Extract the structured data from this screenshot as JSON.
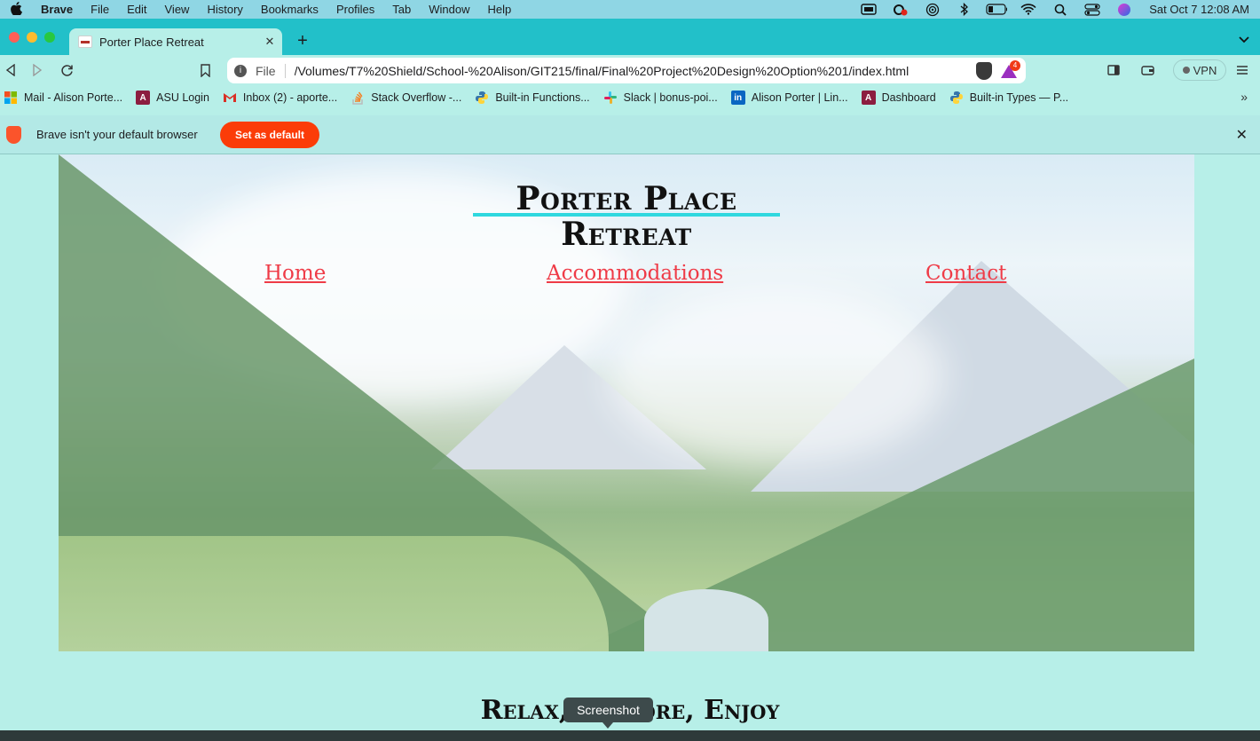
{
  "menubar": {
    "apple": "",
    "app": "Brave",
    "items": [
      "File",
      "Edit",
      "View",
      "History",
      "Bookmarks",
      "Profiles",
      "Tab",
      "Window",
      "Help"
    ],
    "clock": "Sat Oct 7  12:08 AM",
    "status_icons": [
      "screen-mirror-icon",
      "creative-cloud-icon",
      "airdrop-icon",
      "bluetooth-icon",
      "battery-icon",
      "wifi-icon",
      "spotlight-icon",
      "control-center-icon",
      "siri-icon"
    ]
  },
  "tabs": [
    {
      "title": "Porter Place Retreat",
      "close": "✕"
    }
  ],
  "toolbar": {
    "back": "◁",
    "forward": "▷",
    "reload": "↻",
    "bookmark": "⌑",
    "url_scheme": "File",
    "url": "/Volumes/T7%20Shield/School-%20Alison/GIT215/final/Final%20Project%20Design%20Option%201/index.html",
    "rewards_badge": "4",
    "vpn": "VPN"
  },
  "bookmarks": [
    {
      "label": "Mail - Alison Porte...",
      "icon": "microsoft-icon"
    },
    {
      "label": "ASU Login",
      "icon": "asu-icon"
    },
    {
      "label": "Inbox (2) - aporte...",
      "icon": "gmail-icon"
    },
    {
      "label": "Stack Overflow -...",
      "icon": "stackoverflow-icon"
    },
    {
      "label": "Built-in Functions...",
      "icon": "python-icon"
    },
    {
      "label": "Slack | bonus-poi...",
      "icon": "slack-icon"
    },
    {
      "label": "Alison Porter | Lin...",
      "icon": "linkedin-icon"
    },
    {
      "label": "Dashboard",
      "icon": "asu-icon"
    },
    {
      "label": "Built-in Types — P...",
      "icon": "python-icon"
    }
  ],
  "bookmarks_more": "»",
  "infobar": {
    "message": "Brave isn't your default browser",
    "button": "Set as default",
    "close": "✕"
  },
  "page": {
    "title": "Porter Place Retreat",
    "nav": {
      "home": "Home",
      "accommodations": "Accommodations",
      "contact": "Contact"
    },
    "tagline": "Relax, Explore, Enjoy"
  },
  "tooltip": "Screenshot",
  "colors": {
    "tabstrip": "#22c0c9",
    "page_bg": "#b7efe8",
    "nav_link": "#ef3b47",
    "title_underline": "#2fd8df",
    "set_default_button": "#fb3c08"
  }
}
